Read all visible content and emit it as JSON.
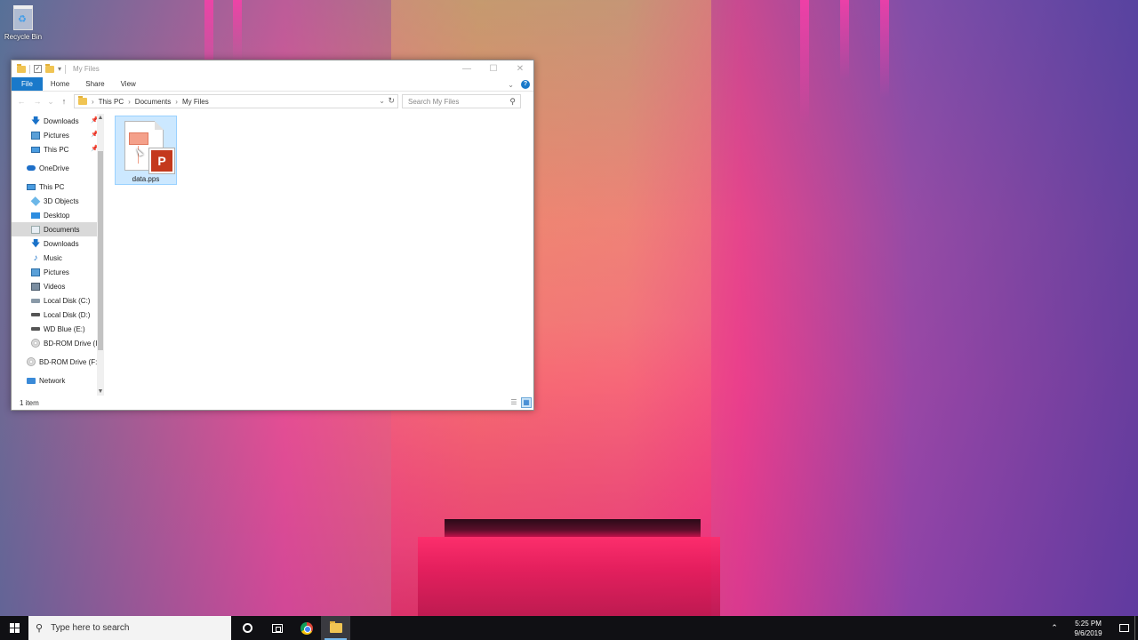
{
  "desktop": {
    "recycle_bin_label": "Recycle Bin"
  },
  "window": {
    "title": "My Files",
    "minimize_glyph": "—",
    "maximize_glyph": "☐",
    "close_glyph": "✕"
  },
  "ribbon": {
    "tabs": [
      "File",
      "Home",
      "Share",
      "View"
    ]
  },
  "address": {
    "crumbs": [
      "This PC",
      "Documents",
      "My Files"
    ],
    "search_placeholder": "Search My Files"
  },
  "navpane": {
    "items": [
      {
        "label": "Downloads",
        "icon": "download-arrow-icon",
        "pinned": true
      },
      {
        "label": "Pictures",
        "icon": "pictures-icon",
        "pinned": true
      },
      {
        "label": "This PC",
        "icon": "computer-icon",
        "pinned": true
      },
      {
        "label": "OneDrive",
        "icon": "onedrive-cloud-icon"
      },
      {
        "label": "This PC",
        "icon": "computer-icon"
      },
      {
        "label": "3D Objects",
        "icon": "3d-objects-icon"
      },
      {
        "label": "Desktop",
        "icon": "desktop-icon"
      },
      {
        "label": "Documents",
        "icon": "documents-icon",
        "selected": true
      },
      {
        "label": "Downloads",
        "icon": "download-arrow-icon"
      },
      {
        "label": "Music",
        "icon": "music-note-icon"
      },
      {
        "label": "Pictures",
        "icon": "pictures-icon"
      },
      {
        "label": "Videos",
        "icon": "videos-icon"
      },
      {
        "label": "Local Disk (C:)",
        "icon": "local-disk-icon"
      },
      {
        "label": "Local Disk (D:)",
        "icon": "drive-icon"
      },
      {
        "label": "WD Blue (E:)",
        "icon": "drive-icon"
      },
      {
        "label": "BD-ROM Drive (I",
        "icon": "cd-drive-icon"
      },
      {
        "label": "BD-ROM Drive (F:",
        "icon": "cd-drive-icon"
      },
      {
        "label": "Network",
        "icon": "network-icon"
      }
    ]
  },
  "content": {
    "files": [
      {
        "name": "data.pps",
        "icon": "powerpoint-show-icon",
        "badge_letter": "P",
        "selected": true
      }
    ]
  },
  "status": {
    "item_count": "1 item"
  },
  "taskbar": {
    "search_placeholder": "Type here to search",
    "time": "5:25 PM",
    "date": "9/6/2019"
  },
  "colors": {
    "accent": "#1979ca",
    "selection_bg": "#cce8ff",
    "selection_border": "#99d1ff",
    "taskbar_bg": "#101014",
    "ppt_red": "#c4391d"
  }
}
